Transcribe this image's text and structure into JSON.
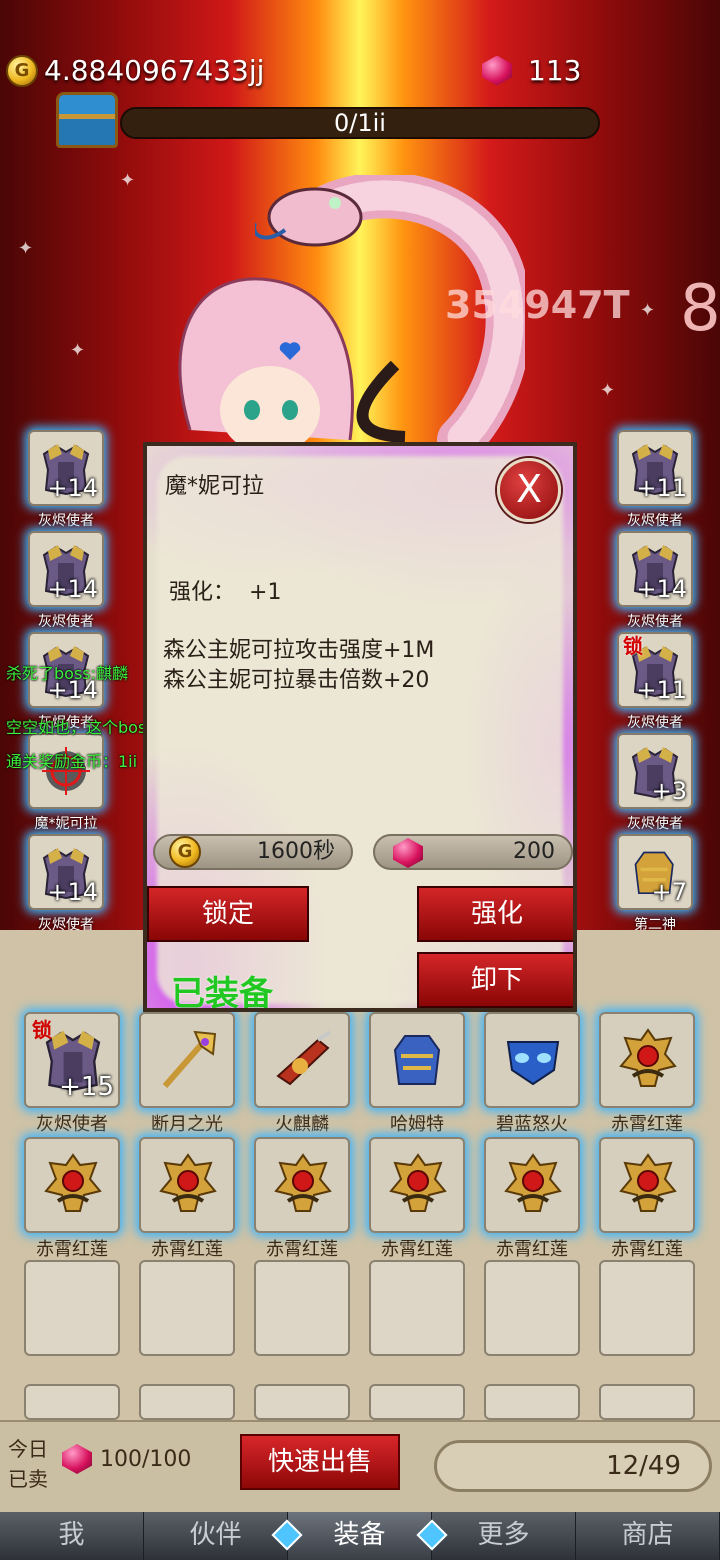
{
  "header": {
    "gold": "4.8840967433jj",
    "gems": "113",
    "stage_progress": "0/1ii"
  },
  "battle": {
    "damage_text": "354947T",
    "combo": "8"
  },
  "left_slots": [
    {
      "name": "灰烬使者",
      "level": "+14",
      "icon": "armor-icon"
    },
    {
      "name": "灰烬使者",
      "level": "+14",
      "icon": "armor-icon"
    },
    {
      "name": "灰烬使者",
      "level": "+14",
      "icon": "armor-icon"
    },
    {
      "name": "魔*妮可拉",
      "level": "",
      "icon": "target-icon"
    },
    {
      "name": "灰烬使者",
      "level": "+14",
      "icon": "armor-icon"
    }
  ],
  "right_slots": [
    {
      "name": "灰烬使者",
      "level": "+11",
      "lock": ""
    },
    {
      "name": "灰烬使者",
      "level": "+14",
      "lock": ""
    },
    {
      "name": "灰烬使者",
      "level": "+11",
      "lock": "锁"
    },
    {
      "name": "灰烬使者",
      "level": "+3",
      "lock": ""
    },
    {
      "name": "第二神",
      "level": "+7",
      "lock": ""
    }
  ],
  "log": [
    "杀死了boss:麒麟",
    "空空如也，这个boss居然没有奖励",
    "通关奖励金币：1ii"
  ],
  "dialog": {
    "title": "魔*妮可拉",
    "close": "X",
    "enhance_label": "强化：",
    "enhance_value": "+1",
    "stats": [
      "森公主妮可拉攻击强度+1M",
      "森公主妮可拉暴击倍数+20"
    ],
    "gold_cost": "1600秒",
    "gem_cost": "200",
    "lock_btn": "锁定",
    "enhance_btn": "强化",
    "unequip_btn": "卸下",
    "status": "已装备"
  },
  "inventory": {
    "items": [
      {
        "name": "灰烬使者",
        "level": "+15",
        "lock": "锁",
        "icon": "armor-icon",
        "color": "#6a4d8a"
      },
      {
        "name": "断月之光",
        "level": "",
        "lock": "",
        "icon": "staff-icon",
        "color": "#c99836"
      },
      {
        "name": "火麒麟",
        "level": "",
        "lock": "",
        "icon": "cannon-icon",
        "color": "#b8321e"
      },
      {
        "name": "哈姆特",
        "level": "",
        "lock": "",
        "icon": "gauntlet-icon",
        "color": "#3a62c0"
      },
      {
        "name": "碧蓝怒火",
        "level": "",
        "lock": "",
        "icon": "mask-icon",
        "color": "#2a5fc8"
      },
      {
        "name": "赤霄红莲",
        "level": "",
        "lock": "",
        "icon": "helm-icon",
        "color": "#d4a23a"
      },
      {
        "name": "赤霄红莲",
        "level": "",
        "lock": "",
        "icon": "helm-icon",
        "color": "#d4a23a"
      },
      {
        "name": "赤霄红莲",
        "level": "",
        "lock": "",
        "icon": "helm-icon",
        "color": "#d4a23a"
      },
      {
        "name": "赤霄红莲",
        "level": "",
        "lock": "",
        "icon": "helm-icon",
        "color": "#d4a23a"
      },
      {
        "name": "赤霄红莲",
        "level": "",
        "lock": "",
        "icon": "helm-icon",
        "color": "#d4a23a"
      },
      {
        "name": "赤霄红莲",
        "level": "",
        "lock": "",
        "icon": "helm-icon",
        "color": "#d4a23a"
      },
      {
        "name": "赤霄红莲",
        "level": "",
        "lock": "",
        "icon": "helm-icon",
        "color": "#d4a23a"
      }
    ]
  },
  "bottom": {
    "sold_label_1": "今日",
    "sold_label_2": "已卖",
    "sold_count": "100/100",
    "quick_sell": "快速出售",
    "capacity": "12/49"
  },
  "nav": {
    "tabs": [
      "我",
      "伙伴",
      "装备",
      "更多",
      "商店"
    ],
    "active": "装备"
  }
}
